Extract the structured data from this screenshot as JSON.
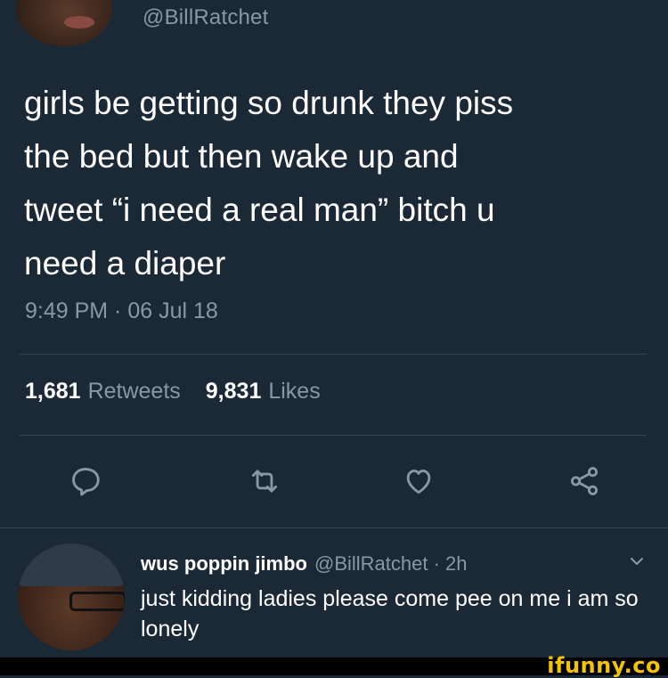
{
  "tweet": {
    "handle": "@BillRatchet",
    "text": "girls be getting so drunk they piss\nthe bed but then wake up and\ntweet “i need a real man” bitch u\nneed a diaper",
    "timestamp": "9:49 PM · 06 Jul 18",
    "retweets_count": "1,681",
    "retweets_label": "Retweets",
    "likes_count": "9,831",
    "likes_label": "Likes"
  },
  "actions": [
    {
      "icon": "reply-icon"
    },
    {
      "icon": "retweet-icon"
    },
    {
      "icon": "heart-icon"
    },
    {
      "icon": "share-icon"
    }
  ],
  "reply": {
    "display_name": "wus poppin jimbo",
    "handle_time": "@BillRatchet · 2h",
    "text": "just kidding ladies please come pee on me i am so lonely"
  },
  "watermark": {
    "text": "ifunny.co",
    "color": "#f5c400"
  },
  "colors": {
    "background": "#1b2836",
    "secondary_text": "#8899a6",
    "divider": "#38444d"
  }
}
